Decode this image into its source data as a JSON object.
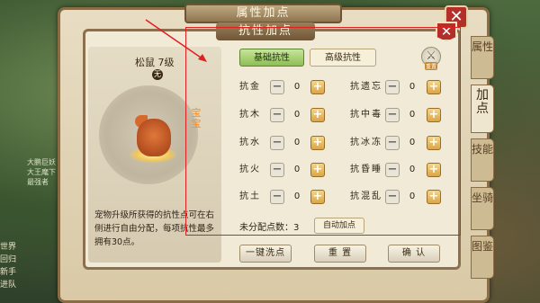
{
  "outer_window": {
    "title": "属性加点",
    "close_glyph": "✕",
    "side_tabs": [
      "属性",
      "加点",
      "技能",
      "坐骑",
      "图鉴"
    ],
    "active_tab_index": 1
  },
  "inner_panel": {
    "title": "抗性加点",
    "close_glyph": "✕"
  },
  "pet": {
    "name": "松鼠 7级",
    "badge": "无",
    "label": "宝宝",
    "description": "宠物升级所获得的抗性点可在右侧进行自由分配，每项抗性最多拥有30点。"
  },
  "tabs": {
    "basic": "基础抗性",
    "advanced": "高级抗性"
  },
  "reset_icon": {
    "icon": "crossed-swords-icon",
    "caption": "重置"
  },
  "stats": [
    {
      "label": "抗金",
      "value": "0"
    },
    {
      "label": "抗木",
      "value": "0"
    },
    {
      "label": "抗水",
      "value": "0"
    },
    {
      "label": "抗火",
      "value": "0"
    },
    {
      "label": "抗土",
      "value": "0"
    },
    {
      "label": "抗遗忘",
      "value": "0"
    },
    {
      "label": "抗中毒",
      "value": "0"
    },
    {
      "label": "抗冰冻",
      "value": "0"
    },
    {
      "label": "抗昏睡",
      "value": "0"
    },
    {
      "label": "抗混乱",
      "value": "0"
    }
  ],
  "stat_controls": {
    "minus": "−",
    "plus": "+"
  },
  "unassigned": "未分配点数：3",
  "auto_button": "自动加点",
  "bottom_buttons": {
    "reset_all": "一键洗点",
    "reset": "重 置",
    "confirm": "确 认"
  },
  "background": {
    "side_text": "大鹏巨妖 大王麾下 最强者",
    "bottom_left": [
      "世界",
      "回归",
      "新手",
      "进队"
    ]
  },
  "colors": {
    "annotation": "#e02020",
    "plus_button": "#d9a548",
    "active_tab": "#8fbd56",
    "close_red": "#b3302a"
  }
}
